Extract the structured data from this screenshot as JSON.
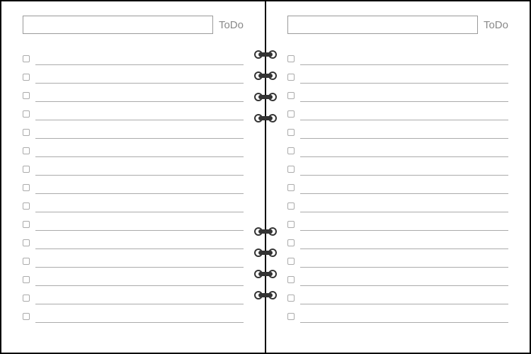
{
  "left": {
    "label": "ToDo",
    "line_count": 15
  },
  "right": {
    "label": "ToDo",
    "line_count": 15
  },
  "ring_positions": [
    70,
    100,
    130,
    160,
    320,
    350,
    380,
    410
  ]
}
